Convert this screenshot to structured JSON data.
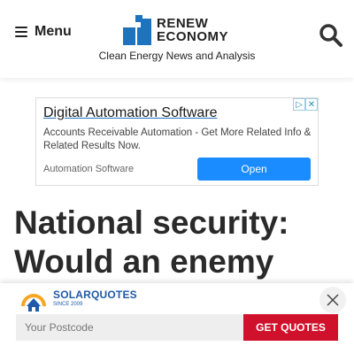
{
  "header": {
    "menu_label": "Menu",
    "logo_line1": "RENEW",
    "logo_line2": "ECONOMY",
    "tagline": "Clean Energy News and Analysis",
    "icons": {
      "menu": "hamburger-icon",
      "search": "search-icon",
      "logo": "reneweconomy-logo"
    },
    "brand_color": "#1e73be"
  },
  "ad": {
    "title": "Digital Automation Software",
    "description": "Accounts Receivable Automation - Get More Related Info & Related Results Now.",
    "source": "Automation Software",
    "button_label": "Open",
    "button_color": "#1a8cff",
    "icons": {
      "adchoices": "adchoices-icon",
      "close": "ad-close-icon"
    }
  },
  "article": {
    "headline": "National security: Would an enemy"
  },
  "sticky_bar": {
    "brand_name": "SOLARQUOTES",
    "brand_since": "SINCE 2009",
    "postcode_placeholder": "Your Postcode",
    "button_label": "GET QUOTES",
    "button_color": "#d0112b",
    "icons": {
      "close": "close-icon",
      "logo": "solarquotes-logo"
    }
  }
}
